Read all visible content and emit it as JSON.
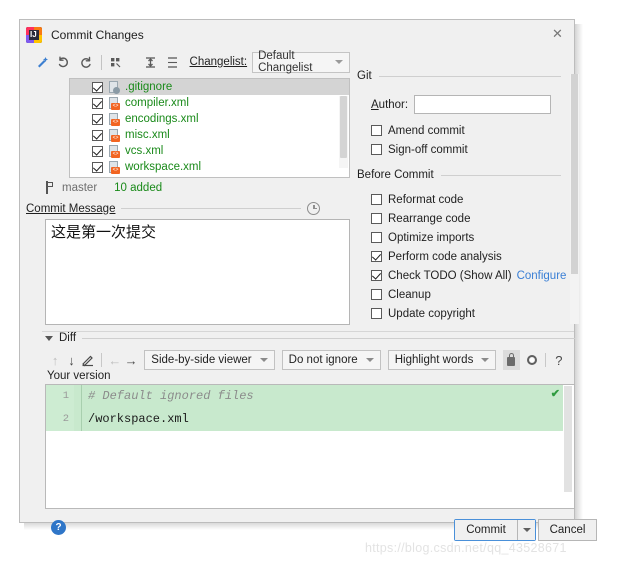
{
  "window": {
    "title": "Commit Changes",
    "app_icon": "intellij-idea-icon",
    "close_label": "✕"
  },
  "toolbar": {
    "buttons": [
      {
        "name": "show-diff-icon",
        "glyph": "magic-wand"
      },
      {
        "name": "rollback-icon",
        "glyph": "rollback"
      },
      {
        "name": "refresh-icon",
        "glyph": "refresh"
      },
      {
        "name": "group-by-icon",
        "glyph": "group-by"
      },
      {
        "name": "expand-all-icon",
        "glyph": "expand-all"
      },
      {
        "name": "collapse-all-icon",
        "glyph": "collapse-all"
      }
    ],
    "changelist_label": "Changelist:",
    "changelist_value": "Default Changelist"
  },
  "file_list": {
    "files": [
      {
        "name": ".gitignore",
        "checked": true,
        "selected": true,
        "icon": "ignore-file-icon"
      },
      {
        "name": "compiler.xml",
        "checked": true,
        "selected": false,
        "icon": "xml-file-icon"
      },
      {
        "name": "encodings.xml",
        "checked": true,
        "selected": false,
        "icon": "xml-file-icon"
      },
      {
        "name": "misc.xml",
        "checked": true,
        "selected": false,
        "icon": "xml-file-icon"
      },
      {
        "name": "vcs.xml",
        "checked": true,
        "selected": false,
        "icon": "xml-file-icon"
      },
      {
        "name": "workspace.xml",
        "checked": true,
        "selected": false,
        "icon": "xml-file-icon"
      }
    ]
  },
  "status": {
    "branch": "master",
    "count": "10 added"
  },
  "commit_message": {
    "title": "Commit Message",
    "history_icon": "clock-icon",
    "value": "这是第一次提交"
  },
  "git_panel": {
    "title": "Git",
    "author_label": "Author:",
    "author_value": "",
    "options": [
      {
        "label": "Amend commit",
        "checked": false,
        "name": "amend-commit-checkbox"
      },
      {
        "label": "Sign-off commit",
        "checked": false,
        "name": "sign-off-commit-checkbox"
      }
    ]
  },
  "before_commit": {
    "title": "Before Commit",
    "options": [
      {
        "label": "Reformat code",
        "checked": false,
        "name": "reformat-code-checkbox",
        "link": ""
      },
      {
        "label": "Rearrange code",
        "checked": false,
        "name": "rearrange-code-checkbox",
        "link": ""
      },
      {
        "label": "Optimize imports",
        "checked": false,
        "name": "optimize-imports-checkbox",
        "link": ""
      },
      {
        "label": "Perform code analysis",
        "checked": true,
        "name": "perform-code-analysis-checkbox",
        "link": ""
      },
      {
        "label": "Check TODO (Show All)",
        "checked": true,
        "name": "check-todo-checkbox",
        "link": "Configure"
      },
      {
        "label": "Cleanup",
        "checked": false,
        "name": "cleanup-checkbox",
        "link": ""
      },
      {
        "label": "Update copyright",
        "checked": false,
        "name": "update-copyright-checkbox",
        "link": ""
      }
    ]
  },
  "diff": {
    "title": "Diff",
    "toolbar": {
      "prev_diff": "↑",
      "next_diff": "↓",
      "edit": "✎",
      "prev_file": "←",
      "next_file": "→",
      "viewer_mode": "Side-by-side viewer",
      "whitespace_mode": "Do not ignore",
      "highlight_mode": "Highlight words",
      "lock_icon": "lock-icon",
      "gear_icon": "gear-icon",
      "help": "?"
    },
    "pane_label": "Your version",
    "lines": [
      {
        "number": "1",
        "text": "# Default ignored files",
        "style": "comment"
      },
      {
        "number": "2",
        "text": "/workspace.xml",
        "style": "normal"
      }
    ],
    "ok_marker": "✔"
  },
  "footer": {
    "help_glyph": "?",
    "commit_label": "Commit",
    "cancel_label": "Cancel"
  },
  "watermark": "https://blog.csdn.net/qq_43528671",
  "colors": {
    "added_green": "#1a8a1a",
    "diff_bg_green": "#c8e9cd",
    "link_blue": "#3a7fd5",
    "focus_blue": "#4a90d9"
  }
}
